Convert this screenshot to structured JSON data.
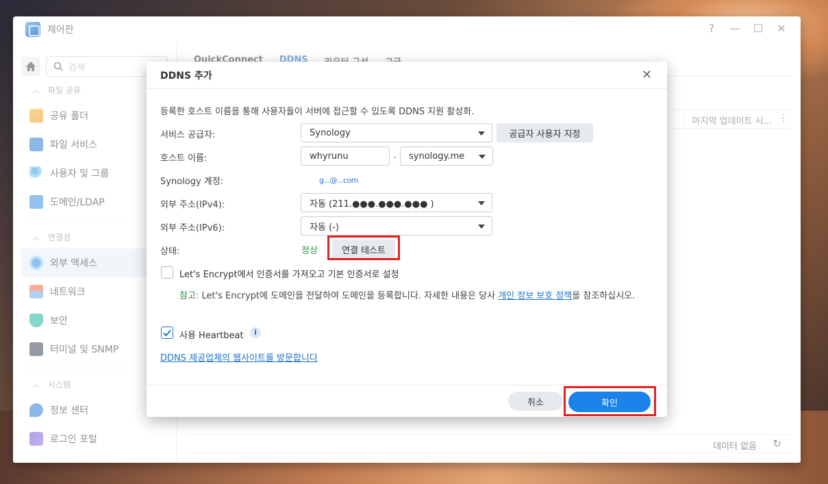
{
  "window": {
    "title": "제어판",
    "controls": [
      "?",
      "—",
      "☐",
      "✕"
    ]
  },
  "sidebar": {
    "search_placeholder": "검색",
    "groups": [
      {
        "label": "파일 공유",
        "items": [
          "공유 폴더",
          "파일 서비스",
          "사용자 및 그룹",
          "도메인/LDAP"
        ]
      },
      {
        "label": "연결성",
        "items": [
          "외부 액세스",
          "네트워크",
          "보안",
          "터미널 및 SNMP"
        ]
      },
      {
        "label": "시스템",
        "items": [
          "정보 센터",
          "로그인 포털"
        ]
      }
    ]
  },
  "content": {
    "tabs": [
      "QuickConnect",
      "DDNS",
      "라우터 구성",
      "고급"
    ],
    "active_tab": "DDNS",
    "last_update_col": "마지막 업데이트 시...",
    "no_data": "데이터 없음"
  },
  "dialog": {
    "title": "DDNS 추가",
    "description": "등록한 호스트 이름을 통해 사용자들이 서버에 접근할 수 있도록 DDNS 지원 활성화.",
    "provider_label": "서비스 공급자:",
    "provider_value": "Synology",
    "custom_provider_button": "공급자 사용자 지정",
    "hostname_label": "호스트 이름:",
    "hostname_value": "whyrunu",
    "dot": ".",
    "domain_value": "synology.me",
    "account_label": "Synology 계정:",
    "account_value": "g...@...com",
    "ipv4_label": "외부 주소(IPv4):",
    "ipv4_value": "자동 (211.●●●.●●●.●●● )",
    "ipv6_label": "외부 주소(IPv6):",
    "ipv6_value": "자동 (-)",
    "status_label": "상태:",
    "status_value": "정상",
    "test_button": "연결 테스트",
    "letsencrypt_label": "Let's Encrypt에서 인증서를 가져오고 기본 인증서로 설정",
    "letsencrypt_checked": false,
    "note_prefix": "참고:",
    "note_text": " Let's Encrypt에 도메인을 전달하여 도메인을 등록합니다. 자세한 내용은 당사 ",
    "note_link": "개인 정보 보호 정책",
    "note_suffix": "을 참조하십시오.",
    "heartbeat_label": "사용 Heartbeat",
    "heartbeat_checked": true,
    "provider_link": "DDNS 제공업체의 웹사이트를 방문합니다",
    "cancel_button": "취소",
    "ok_button": "확인"
  },
  "colors": {
    "accent": "#1a82e8",
    "highlight_box": "#e02222",
    "status_ok": "#2a9a3a"
  }
}
